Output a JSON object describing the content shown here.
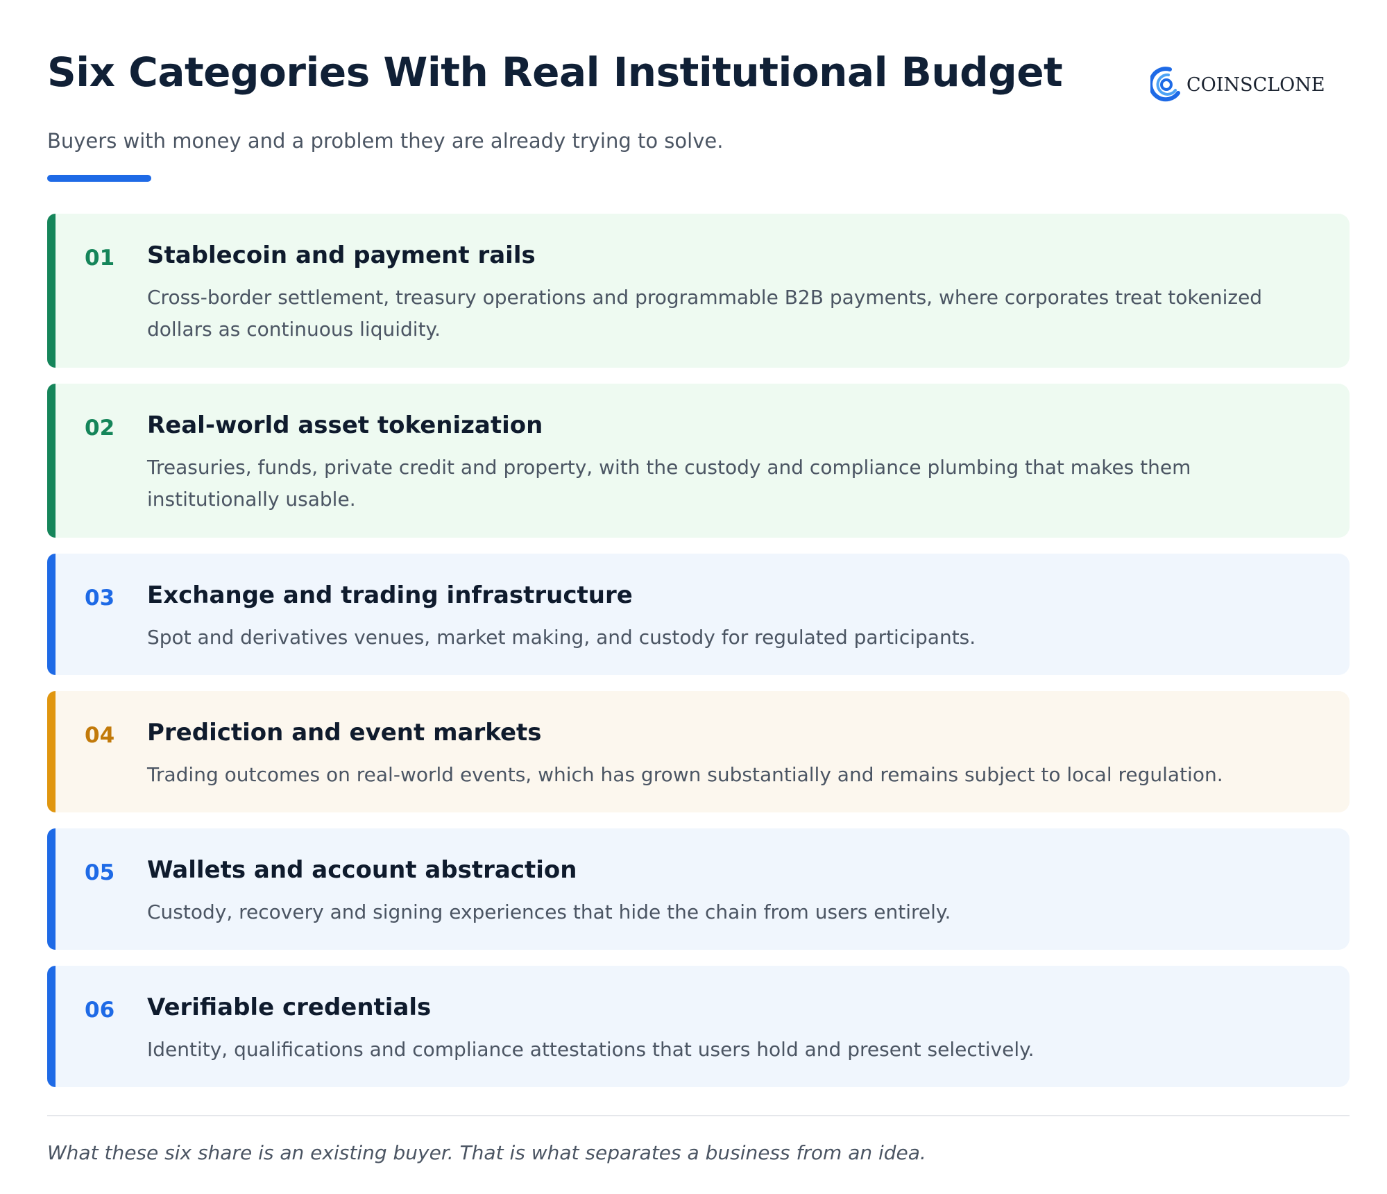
{
  "header": {
    "title": "Six Categories With Real Institutional Budget",
    "subtitle": "Buyers with money and a problem they are already trying to solve.",
    "logo_text": "COINSCLONE"
  },
  "colors": {
    "accent_blue": "#1e6ae6",
    "green": "#15855a",
    "amber": "#e0960f",
    "green_bg": "#eefaf1",
    "blue_bg": "#f0f6fd",
    "amber_bg": "#fcf7ee"
  },
  "categories": [
    {
      "number": "01",
      "title": "Stablecoin and payment rails",
      "description": "Cross-border settlement, treasury operations and programmable B2B payments, where corporates treat tokenized dollars as continuous liquidity."
    },
    {
      "number": "02",
      "title": "Real-world asset tokenization",
      "description": "Treasuries, funds, private credit and property, with the custody and compliance plumbing that makes them institutionally usable."
    },
    {
      "number": "03",
      "title": "Exchange and trading infrastructure",
      "description": "Spot and derivatives venues, market making, and custody for regulated participants."
    },
    {
      "number": "04",
      "title": "Prediction and event markets",
      "description": "Trading outcomes on real-world events, which has grown substantially and remains subject to local regulation."
    },
    {
      "number": "05",
      "title": "Wallets and account abstraction",
      "description": "Custody, recovery and signing experiences that hide the chain from users entirely."
    },
    {
      "number": "06",
      "title": "Verifiable credentials",
      "description": "Identity, qualifications and compliance attestations that users hold and present selectively."
    }
  ],
  "footer": {
    "note": "What these six share is an existing buyer. That is what separates a business from an idea."
  }
}
